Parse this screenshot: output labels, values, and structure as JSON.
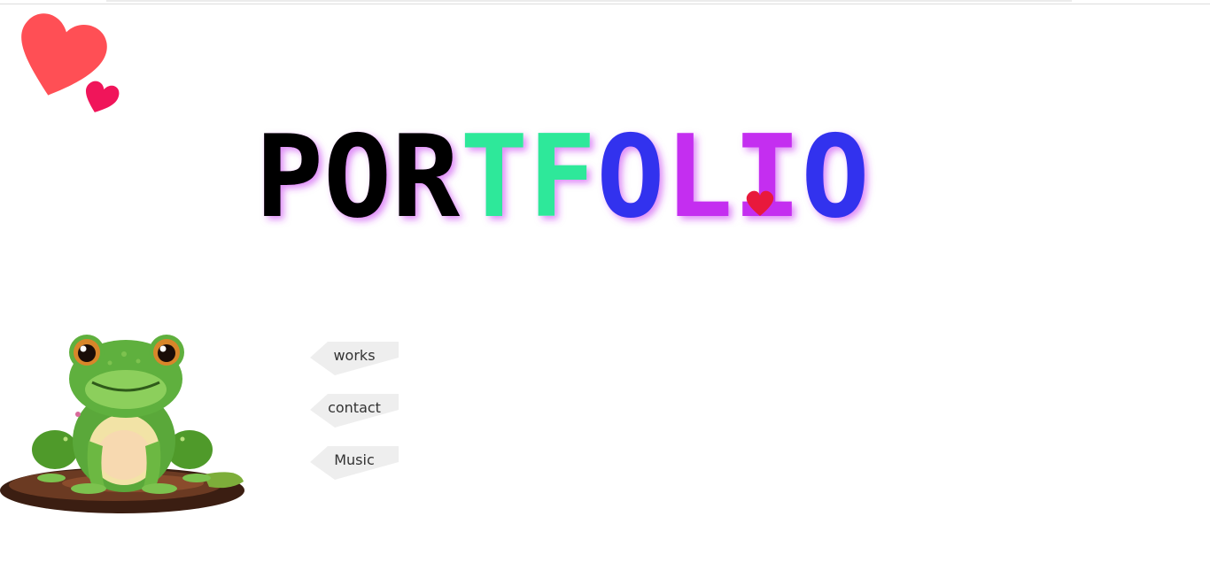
{
  "header": {
    "title": "PORTFOLIO",
    "logo_icon": "hearts-icon",
    "letter_colors": [
      "#000000",
      "#000000",
      "#000000",
      "#2ee89a",
      "#2ee89a",
      "#3333ee",
      "#c42ef0",
      "#c42ef0",
      "#3333ee",
      "#2ee89a"
    ],
    "accent_heart_color": "#e8193c"
  },
  "mascot": {
    "icon": "frog-illustration"
  },
  "nav": {
    "items": [
      {
        "label": "works"
      },
      {
        "label": "contact"
      },
      {
        "label": "Music"
      }
    ],
    "tab_color": "#eeeeee"
  }
}
